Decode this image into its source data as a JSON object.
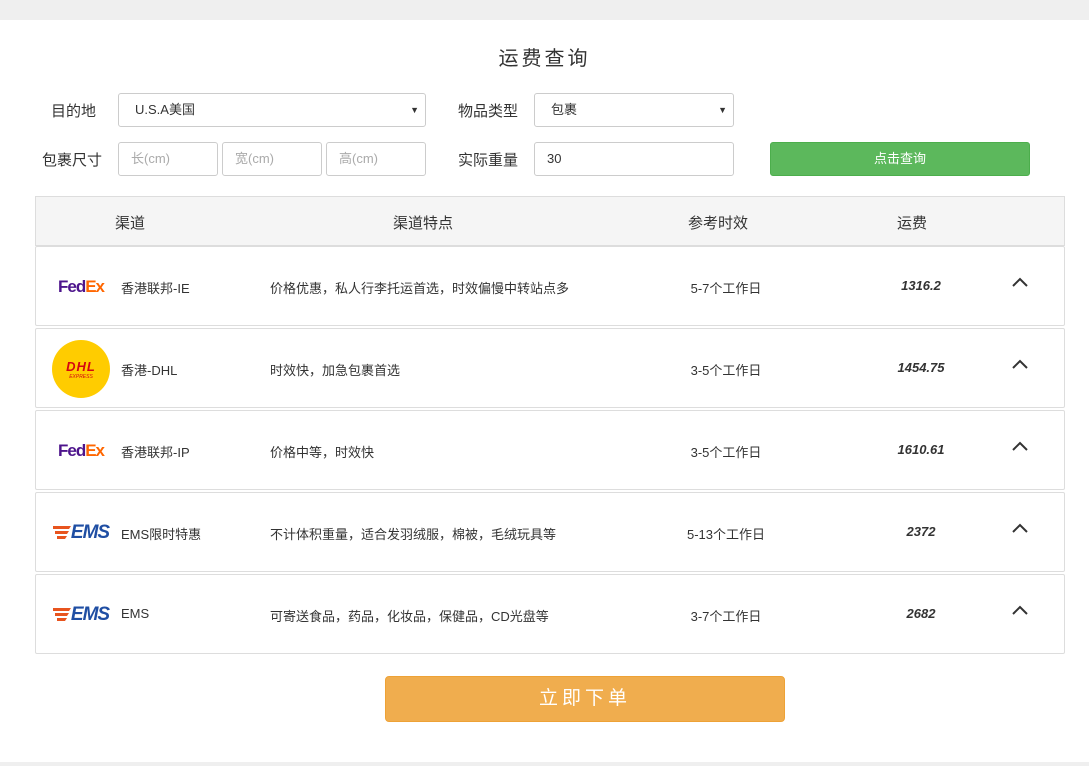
{
  "page": {
    "title": "运费查询"
  },
  "form": {
    "destination_label": "目的地",
    "destination_value": "U.S.A美国",
    "item_type_label": "物品类型",
    "item_type_value": "包裹",
    "size_label": "包裹尺寸",
    "length_placeholder": "长(cm)",
    "width_placeholder": "宽(cm)",
    "height_placeholder": "高(cm)",
    "weight_label": "实际重量",
    "weight_value": "30",
    "query_button": "点击查询"
  },
  "table": {
    "headers": [
      "渠道",
      "渠道特点",
      "参考时效",
      "运费"
    ],
    "rows": [
      {
        "logo": "fedex-logo",
        "name": "香港联邦-IE",
        "feature": "价格优惠，私人行李托运首选，时效偏慢中转站点多",
        "time": "5-7个工作日",
        "price": "1316.2"
      },
      {
        "logo": "dhl-logo",
        "name": "香港-DHL",
        "feature": "时效快，加急包裹首选",
        "time": "3-5个工作日",
        "price": "1454.75"
      },
      {
        "logo": "fedex-logo",
        "name": "香港联邦-IP",
        "feature": "价格中等，时效快",
        "time": "3-5个工作日",
        "price": "1610.61"
      },
      {
        "logo": "ems-logo",
        "name": "EMS限时特惠",
        "feature": "不计体积重量，适合发羽绒服，棉被，毛绒玩具等",
        "time": "5-13个工作日",
        "price": "2372"
      },
      {
        "logo": "ems-logo",
        "name": "EMS",
        "feature": "可寄送食品，药品，化妆品，保健品，CD光盘等",
        "time": "3-7个工作日",
        "price": "2682"
      }
    ]
  },
  "logos": {
    "fedex_fe": "Fed",
    "fedex_ex": "Ex",
    "dhl_text": "DHL",
    "dhl_sub": "EXPRESS",
    "ems_text": "EMS"
  },
  "order_button": "立即下单",
  "colors": {
    "query_button": "#5cb85c",
    "order_button": "#f0ad4e",
    "fedex_purple": "#4d148c",
    "fedex_orange": "#ff6600",
    "dhl_yellow": "#ffcc00",
    "dhl_red": "#d40511",
    "ems_blue": "#1f4ea3",
    "ems_orange": "#e8541e"
  }
}
